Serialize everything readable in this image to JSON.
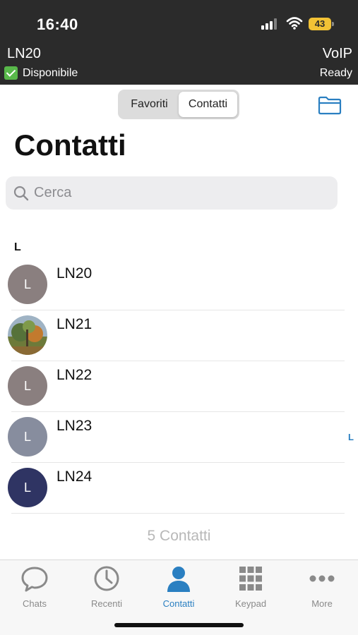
{
  "status_bar": {
    "time": "16:40",
    "battery": "43"
  },
  "header": {
    "account": "LN20",
    "presence": "Disponibile",
    "service": "VoIP",
    "service_state": "Ready"
  },
  "segments": {
    "favorites": "Favoriti",
    "contacts": "Contatti",
    "selected": "Contatti"
  },
  "page": {
    "title": "Contatti"
  },
  "search": {
    "placeholder": "Cerca",
    "value": ""
  },
  "section_letter": "L",
  "contacts": [
    {
      "name": "LN20",
      "initial": "L",
      "avatar_color": "#8a7f7f"
    },
    {
      "name": "LN21",
      "initial": "",
      "avatar_color": "#6f7c52",
      "photo": true
    },
    {
      "name": "LN22",
      "initial": "L",
      "avatar_color": "#8a7f7f"
    },
    {
      "name": "LN23",
      "initial": "L",
      "avatar_color": "#878d9e"
    },
    {
      "name": "LN24",
      "initial": "L",
      "avatar_color": "#2f3463"
    }
  ],
  "index_letter": "L",
  "count_text": "5 Contatti",
  "tabs": [
    {
      "label": "Chats",
      "icon": "chat-bubble-icon"
    },
    {
      "label": "Recenti",
      "icon": "clock-icon"
    },
    {
      "label": "Contatti",
      "icon": "person-icon",
      "active": true
    },
    {
      "label": "Keypad",
      "icon": "keypad-grid-icon"
    },
    {
      "label": "More",
      "icon": "more-dots-icon"
    }
  ],
  "colors": {
    "accent": "#2a7fc1",
    "top_bar": "#2b2b2b",
    "presence_green": "#58b84a",
    "battery": "#f2c235"
  }
}
